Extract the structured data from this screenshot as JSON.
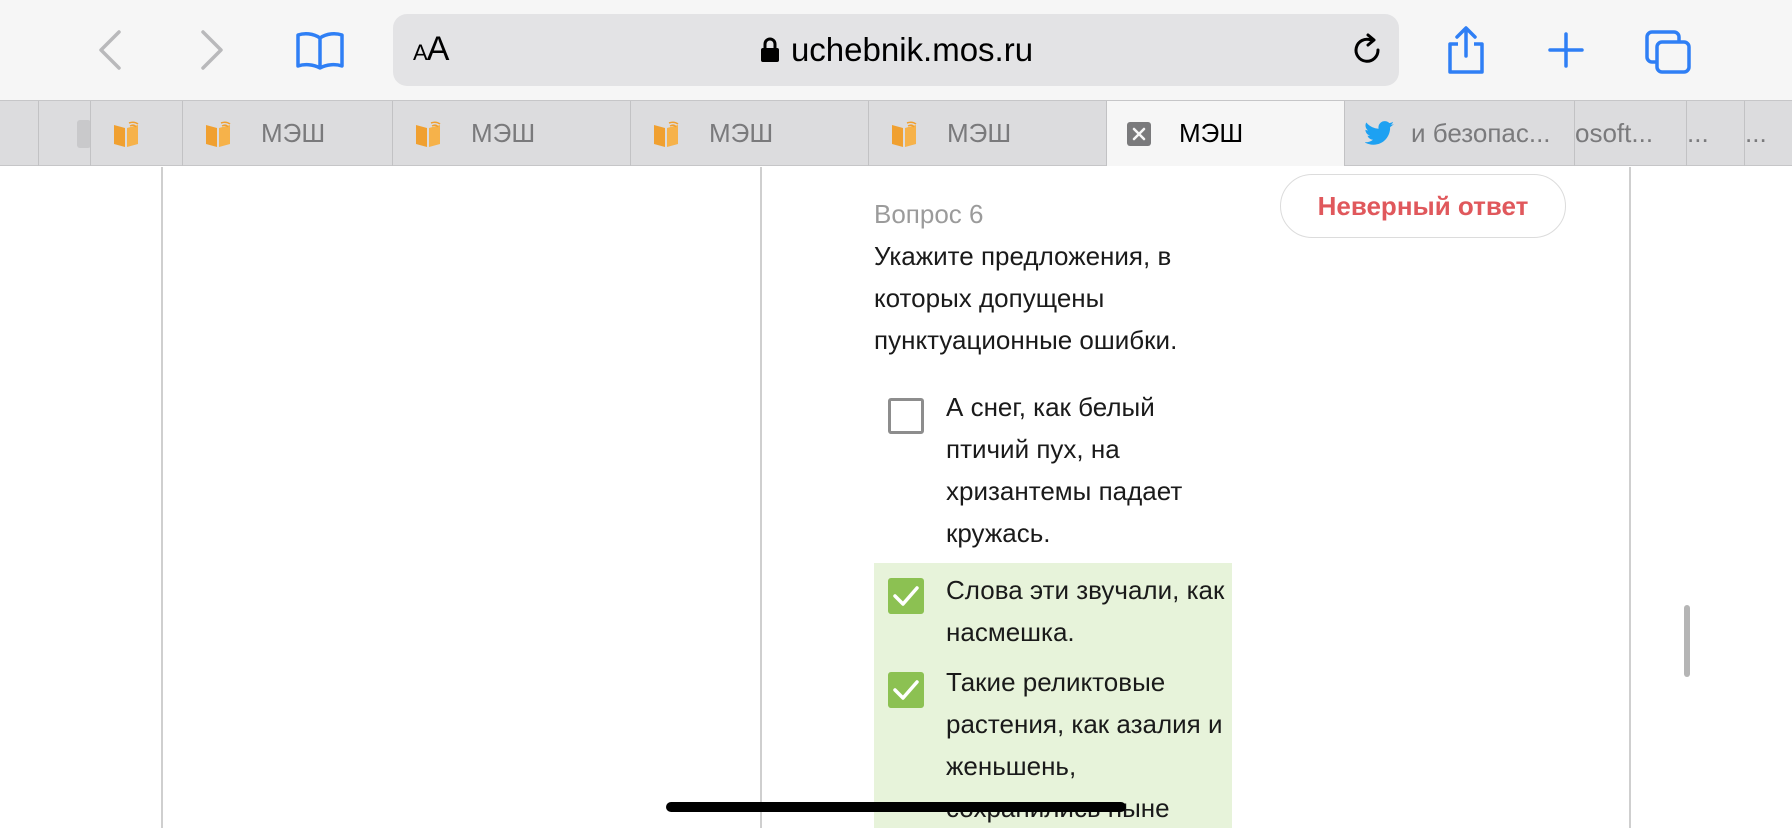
{
  "browser": {
    "address": {
      "text_size_label_small": "A",
      "text_size_label_large": "A",
      "url": "uchebnik.mos.ru"
    },
    "icons": [
      "chevron-left-icon",
      "chevron-right-icon",
      "book-icon",
      "lock-icon",
      "reload-icon",
      "share-icon",
      "plus-icon",
      "tabs-icon"
    ]
  },
  "tabs": [
    {
      "label": "",
      "icon": "partial"
    },
    {
      "label": "",
      "icon": "book-logo-icon"
    },
    {
      "label": "МЭШ",
      "icon": "book-logo-icon"
    },
    {
      "label": "МЭШ",
      "icon": "book-logo-icon"
    },
    {
      "label": "МЭШ",
      "icon": "book-logo-icon"
    },
    {
      "label": "МЭШ",
      "icon": "book-logo-icon"
    },
    {
      "label": "МЭШ",
      "icon": "close-icon",
      "active": true
    },
    {
      "label": "и безопас...",
      "icon": "twitter-icon"
    },
    {
      "label": "osoft...",
      "icon": "none"
    },
    {
      "label": "...",
      "icon": "none"
    },
    {
      "label": "...",
      "icon": "none"
    }
  ],
  "question": {
    "number_label": "Вопрос 6",
    "text": "Укажите предложения, в которых допущены пунктуационные ошибки.",
    "result_badge": "Неверный ответ",
    "options": [
      {
        "text": "А снег, как белый птичий пух, на хризантемы падает кружась.",
        "checked": false
      },
      {
        "text": "Слова эти звучали, как насмешка.",
        "checked": true
      },
      {
        "text": "Такие реликтовые растения, как азалия и женьшень, сохранились ныне",
        "checked": true
      }
    ]
  },
  "colors": {
    "accent": "#2f7ff5",
    "error": "#e0585c",
    "checked_bg": "#e7f3da",
    "checkbox_on": "#8cc152",
    "tab_logo": "#f0a030",
    "twitter": "#1da1f2"
  }
}
